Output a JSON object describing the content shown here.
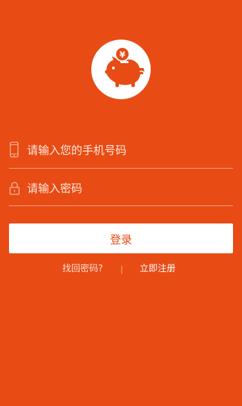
{
  "login": {
    "phone_placeholder": "请输入您的手机号码",
    "phone_value": "",
    "password_placeholder": "请输入密码",
    "password_value": "",
    "login_button": "登录",
    "forgot_password": "找回密码?",
    "separator": "|",
    "register": "立即注册"
  },
  "icons": {
    "logo": "piggy-bank-icon",
    "phone": "phone-icon",
    "lock": "lock-icon",
    "coin_symbol": "¥"
  },
  "colors": {
    "background": "#e84b14",
    "button": "#ffffff",
    "button_text": "#e84b14"
  }
}
